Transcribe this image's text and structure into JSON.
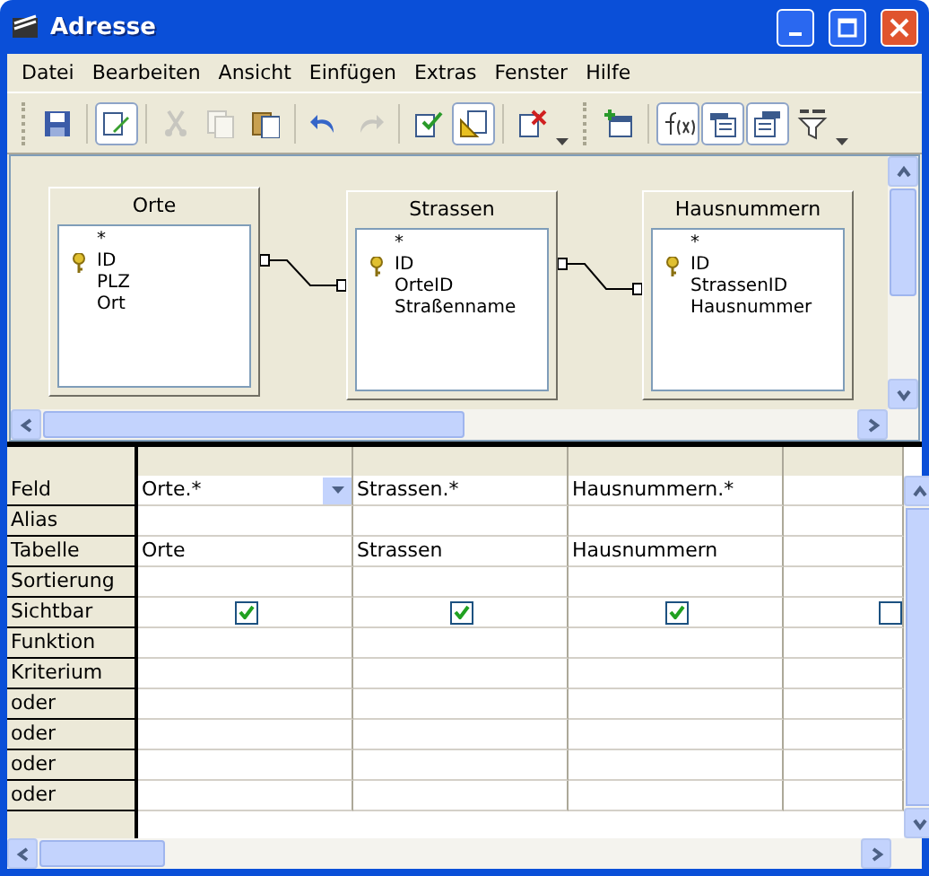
{
  "window": {
    "title": "Adresse"
  },
  "menu": [
    "Datei",
    "Bearbeiten",
    "Ansicht",
    "Einfügen",
    "Extras",
    "Fenster",
    "Hilfe"
  ],
  "toolbar": [
    {
      "kind": "save",
      "pressed": false,
      "disabled": false
    },
    {
      "kind": "sep"
    },
    {
      "kind": "edit",
      "pressed": true,
      "disabled": false
    },
    {
      "kind": "sep"
    },
    {
      "kind": "cut",
      "pressed": false,
      "disabled": true
    },
    {
      "kind": "copy",
      "pressed": false,
      "disabled": true
    },
    {
      "kind": "paste",
      "pressed": false,
      "disabled": false
    },
    {
      "kind": "sep"
    },
    {
      "kind": "undo",
      "pressed": false,
      "disabled": false
    },
    {
      "kind": "redo",
      "pressed": false,
      "disabled": true
    },
    {
      "kind": "sep"
    },
    {
      "kind": "run",
      "pressed": false,
      "disabled": false
    },
    {
      "kind": "design",
      "pressed": true,
      "disabled": false
    },
    {
      "kind": "sep"
    },
    {
      "kind": "clear",
      "pressed": false,
      "disabled": false
    },
    {
      "kind": "more"
    },
    {
      "kind": "grip"
    },
    {
      "kind": "addtable",
      "pressed": false,
      "disabled": false
    },
    {
      "kind": "sep"
    },
    {
      "kind": "function",
      "pressed": true,
      "disabled": false
    },
    {
      "kind": "tablename",
      "pressed": true,
      "disabled": false
    },
    {
      "kind": "alias",
      "pressed": true,
      "disabled": false
    },
    {
      "kind": "distinct",
      "pressed": false,
      "disabled": false
    },
    {
      "kind": "more"
    }
  ],
  "tables": [
    {
      "name": "Orte",
      "fields": [
        {
          "name": "*",
          "key": false
        },
        {
          "name": "ID",
          "key": true
        },
        {
          "name": "PLZ",
          "key": false
        },
        {
          "name": "Ort",
          "key": false
        }
      ]
    },
    {
      "name": "Strassen",
      "fields": [
        {
          "name": "*",
          "key": false
        },
        {
          "name": "ID",
          "key": true
        },
        {
          "name": "OrteID",
          "key": false
        },
        {
          "name": "Straßenname",
          "key": false
        }
      ]
    },
    {
      "name": "Hausnummern",
      "fields": [
        {
          "name": "*",
          "key": false
        },
        {
          "name": "ID",
          "key": true
        },
        {
          "name": "StrassenID",
          "key": false
        },
        {
          "name": "Hausnummer",
          "key": false
        }
      ]
    }
  ],
  "grid": {
    "row_labels": [
      "Feld",
      "Alias",
      "Tabelle",
      "Sortierung",
      "Sichtbar",
      "Funktion",
      "Kriterium",
      "oder",
      "oder",
      "oder",
      "oder"
    ],
    "columns": [
      {
        "field": "Orte.*",
        "table": "Orte",
        "visible": true,
        "selected": true
      },
      {
        "field": "Strassen.*",
        "table": "Strassen",
        "visible": true,
        "selected": false
      },
      {
        "field": "Hausnummern.*",
        "table": "Hausnummern",
        "visible": true,
        "selected": false
      },
      {
        "visible": false,
        "selected": false
      }
    ]
  }
}
